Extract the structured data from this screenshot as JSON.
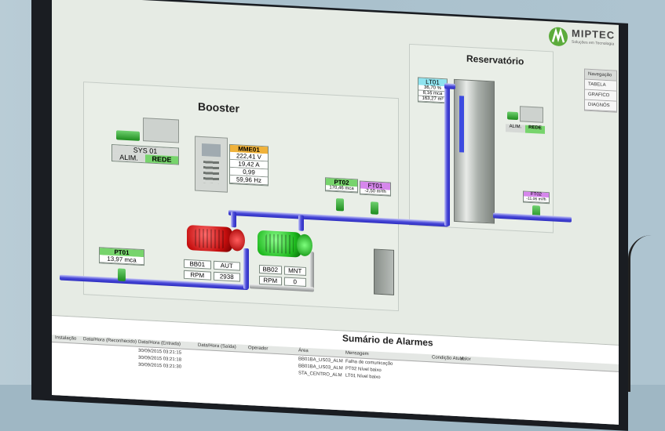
{
  "brand": {
    "name": "MIPTEC",
    "tagline": "Soluções em Tecnologia"
  },
  "navigation": {
    "title": "Navegação",
    "items": [
      "TABELA",
      "GRAFICO",
      "DIAGNÓS"
    ]
  },
  "booster": {
    "title": "Booster",
    "sys": {
      "name": "SYS 01",
      "alim": "ALIM.",
      "rede": "REDE"
    },
    "mme": {
      "name": "MME01",
      "values": [
        "222,41 V",
        "19,42 A",
        "0,99",
        "59,96 Hz"
      ]
    },
    "pt01": {
      "name": "PT01",
      "value": "13,97 mca"
    },
    "pt02": {
      "name": "PT02",
      "value": "170,46 mca"
    },
    "ft01": {
      "name": "FT01",
      "value": "-2,50 m³/h"
    },
    "bb01": {
      "name": "BB01",
      "mode": "AUT",
      "rpm_label": "RPM",
      "rpm": "2938"
    },
    "bb02": {
      "name": "BB02",
      "mode": "MNT",
      "rpm_label": "RPM",
      "rpm": "0"
    }
  },
  "reservatorio": {
    "title": "Reservatório",
    "lt01": {
      "name": "LT01",
      "values": [
        "36,70 %",
        "8,16 mca",
        "163,27 m³"
      ]
    },
    "device": {
      "alim": "ALIM.",
      "rede": "REDE"
    },
    "ft02": {
      "name": "FT02",
      "value": "-11,06 m³/h"
    }
  },
  "alarms": {
    "title": "Sumário de Alarmes",
    "columns": [
      "Instalação",
      "Data/Hora (Reconhecido)",
      "Data/Hora (Entrada)",
      "Data/Hora (Saída)",
      "Operador",
      "Área",
      "Mensagem",
      "Condição Atual",
      "Valor"
    ],
    "rows": [
      {
        "entrada": "30/09/2015 03:21:15",
        "area": "BB01BA_US03_ALM",
        "msg": "Falha de comunicação"
      },
      {
        "entrada": "30/09/2015 03:21:18",
        "area": "BB01BA_US03_ALM",
        "msg": "PT02 Nível baixo"
      },
      {
        "entrada": "30/09/2015 03:21:30",
        "area": "STA_CENTRO_ALM",
        "msg": "LT01 Nível baixo"
      }
    ]
  }
}
